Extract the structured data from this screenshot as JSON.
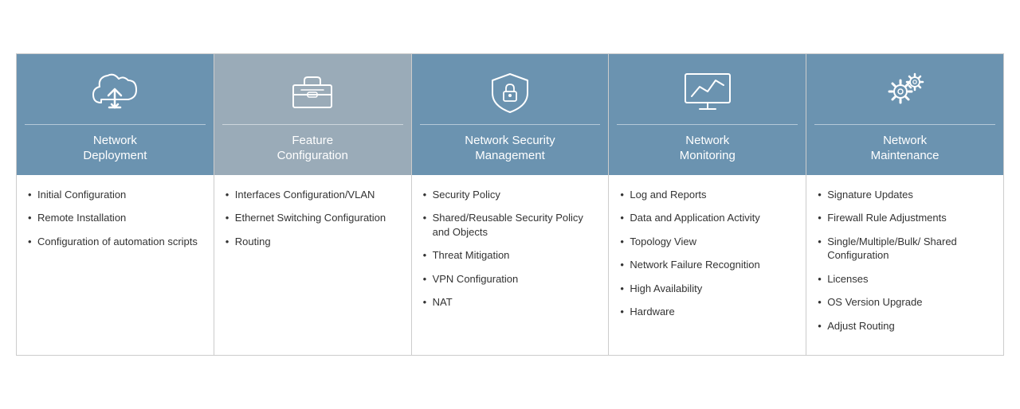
{
  "columns": [
    {
      "id": "network-deployment",
      "icon": "cloud-upload",
      "title": "Network\nDeployment",
      "items": [
        "Initial Configuration",
        "Remote Installation",
        "Configuration of automation scripts"
      ]
    },
    {
      "id": "feature-configuration",
      "icon": "toolbox",
      "title": "Feature\nConfiguration",
      "items": [
        "Interfaces Configuration/VLAN",
        "Ethernet Switching Configuration",
        "Routing"
      ]
    },
    {
      "id": "network-security-management",
      "icon": "shield-lock",
      "title": "Network Security\nManagement",
      "items": [
        "Security Policy",
        "Shared/Reusable Security Policy and Objects",
        "Threat Mitigation",
        "VPN Configuration",
        "NAT"
      ]
    },
    {
      "id": "network-monitoring",
      "icon": "monitor-chart",
      "title": "Network\nMonitoring",
      "items": [
        "Log and Reports",
        "Data and Application Activity",
        "Topology View",
        "Network Failure Recognition",
        "High Availability",
        "Hardware"
      ]
    },
    {
      "id": "network-maintenance",
      "icon": "gear",
      "title": "Network\nMaintenance",
      "items": [
        "Signature Updates",
        "Firewall Rule Adjustments",
        "Single/Multiple/Bulk/ Shared Configuration",
        "Licenses",
        "OS Version Upgrade",
        "Adjust Routing"
      ]
    }
  ]
}
